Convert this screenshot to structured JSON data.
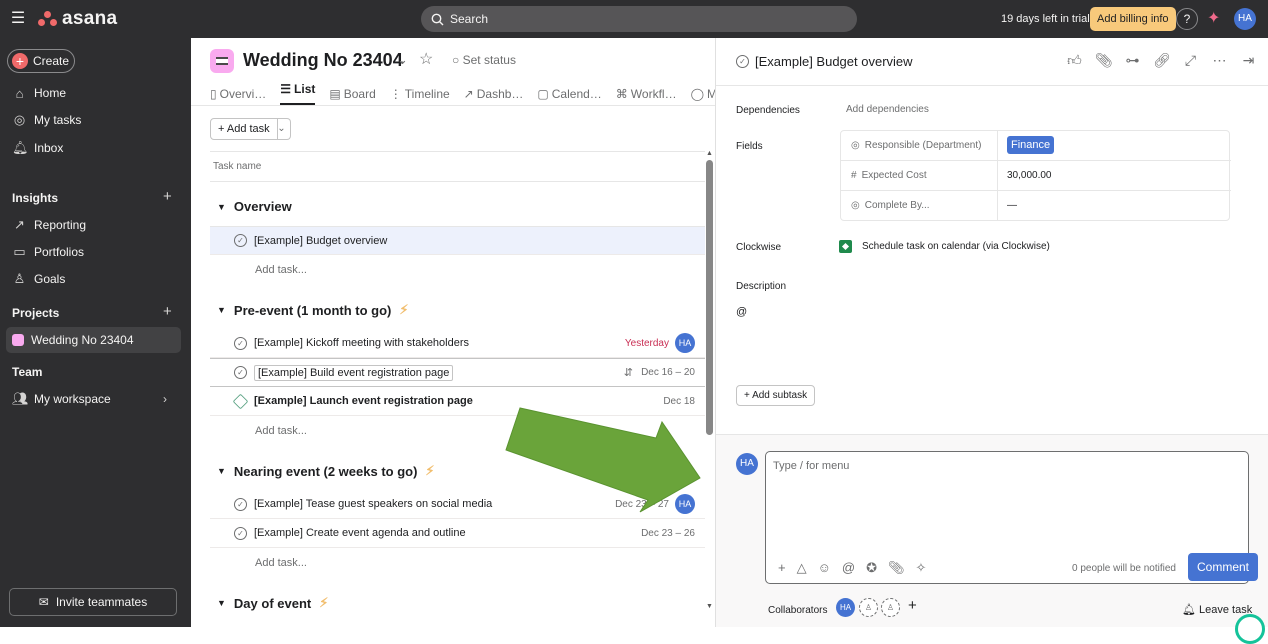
{
  "topbar": {
    "brand": "asana",
    "search_placeholder": "Search",
    "trial": "19 days left in trial",
    "billing": "Add billing info",
    "help": "?",
    "user_initials": "HA",
    "colors": {
      "bg": "#2e2e30",
      "billing": "#f8c97b",
      "brand": "#f06a6a"
    }
  },
  "sidebar": {
    "create_label": "Create",
    "nav": [
      {
        "label": "Home",
        "icon": "home-icon"
      },
      {
        "label": "My tasks",
        "icon": "check-circle-icon"
      },
      {
        "label": "Inbox",
        "icon": "bell-icon"
      }
    ],
    "insights_label": "Insights",
    "insights": [
      {
        "label": "Reporting",
        "icon": "chart-line-icon"
      },
      {
        "label": "Portfolios",
        "icon": "folder-icon"
      },
      {
        "label": "Goals",
        "icon": "person-icon"
      }
    ],
    "projects_label": "Projects",
    "project": "Wedding No 23404",
    "team_label": "Team",
    "workspace": "My workspace",
    "invite": "Invite teammates"
  },
  "project": {
    "title": "Wedding No 23404",
    "set_status": "Set status",
    "tabs": [
      {
        "label": "Overvi…",
        "icon": "overview-icon"
      },
      {
        "label": "List",
        "icon": "list-icon",
        "active": true
      },
      {
        "label": "Board",
        "icon": "board-icon"
      },
      {
        "label": "Timeline",
        "icon": "timeline-icon"
      },
      {
        "label": "Dashb…",
        "icon": "dashboard-icon"
      },
      {
        "label": "Calend…",
        "icon": "calendar-icon"
      },
      {
        "label": "Workfl…",
        "icon": "workflow-icon"
      },
      {
        "label": "M",
        "icon": "message-icon"
      }
    ],
    "add_task": "Add task",
    "column_header": "Task name",
    "add_task_row": "Add task...",
    "sections": [
      {
        "name": "Overview",
        "bolt": false,
        "tasks": [
          {
            "name": "[Example] Budget overview",
            "date": "",
            "assignee": "",
            "selected": true
          }
        ]
      },
      {
        "name": "Pre-event (1 month to go)",
        "bolt": true,
        "tasks": [
          {
            "name": "[Example] Kickoff meeting with stakeholders",
            "date": "Yesterday",
            "assignee": "HA",
            "overdue": true
          },
          {
            "name": "[Example] Build event registration page",
            "date": "Dec 16 – 20",
            "assignee": "",
            "hovered": true,
            "dependency_icon": true
          },
          {
            "name": "[Example] Launch event registration page",
            "date": "Dec 18",
            "assignee": "",
            "milestone": true
          }
        ]
      },
      {
        "name": "Nearing event (2 weeks to go)",
        "bolt": true,
        "tasks": [
          {
            "name": "[Example] Tease guest speakers on social media",
            "date": "Dec 23 – 27",
            "assignee": "HA"
          },
          {
            "name": "[Example] Create event agenda and outline",
            "date": "Dec 23 – 26",
            "assignee": ""
          }
        ]
      },
      {
        "name": "Day of event",
        "bolt": true,
        "tasks": []
      }
    ]
  },
  "panel": {
    "title": "[Example] Budget overview",
    "icons": [
      "thumbs-up-icon",
      "attachment-icon",
      "subtasks-icon",
      "link-icon",
      "expand-icon",
      "more-icon",
      "close-panel-icon"
    ],
    "dependencies_label": "Dependencies",
    "dependencies_value": "Add dependencies",
    "fields_label": "Fields",
    "fields": [
      {
        "name": "Responsible (Department)",
        "value": "Finance",
        "icon": "circle-check-icon",
        "tag": true
      },
      {
        "name": "Expected Cost",
        "value": "30,000.00",
        "icon": "hash-icon"
      },
      {
        "name": "Complete By...",
        "value": "—",
        "icon": "circle-check-icon"
      }
    ],
    "clockwise_label": "Clockwise",
    "clockwise_value": "Schedule task on calendar (via Clockwise)",
    "description_label": "Description",
    "description_value": "@",
    "add_subtask": "Add subtask",
    "comment": {
      "avatar": "HA",
      "placeholder": "Type / for menu",
      "notify": "0 people will be notified",
      "button": "Comment",
      "collaborators_label": "Collaborators",
      "collaborator": "HA",
      "leave": "Leave task"
    }
  }
}
